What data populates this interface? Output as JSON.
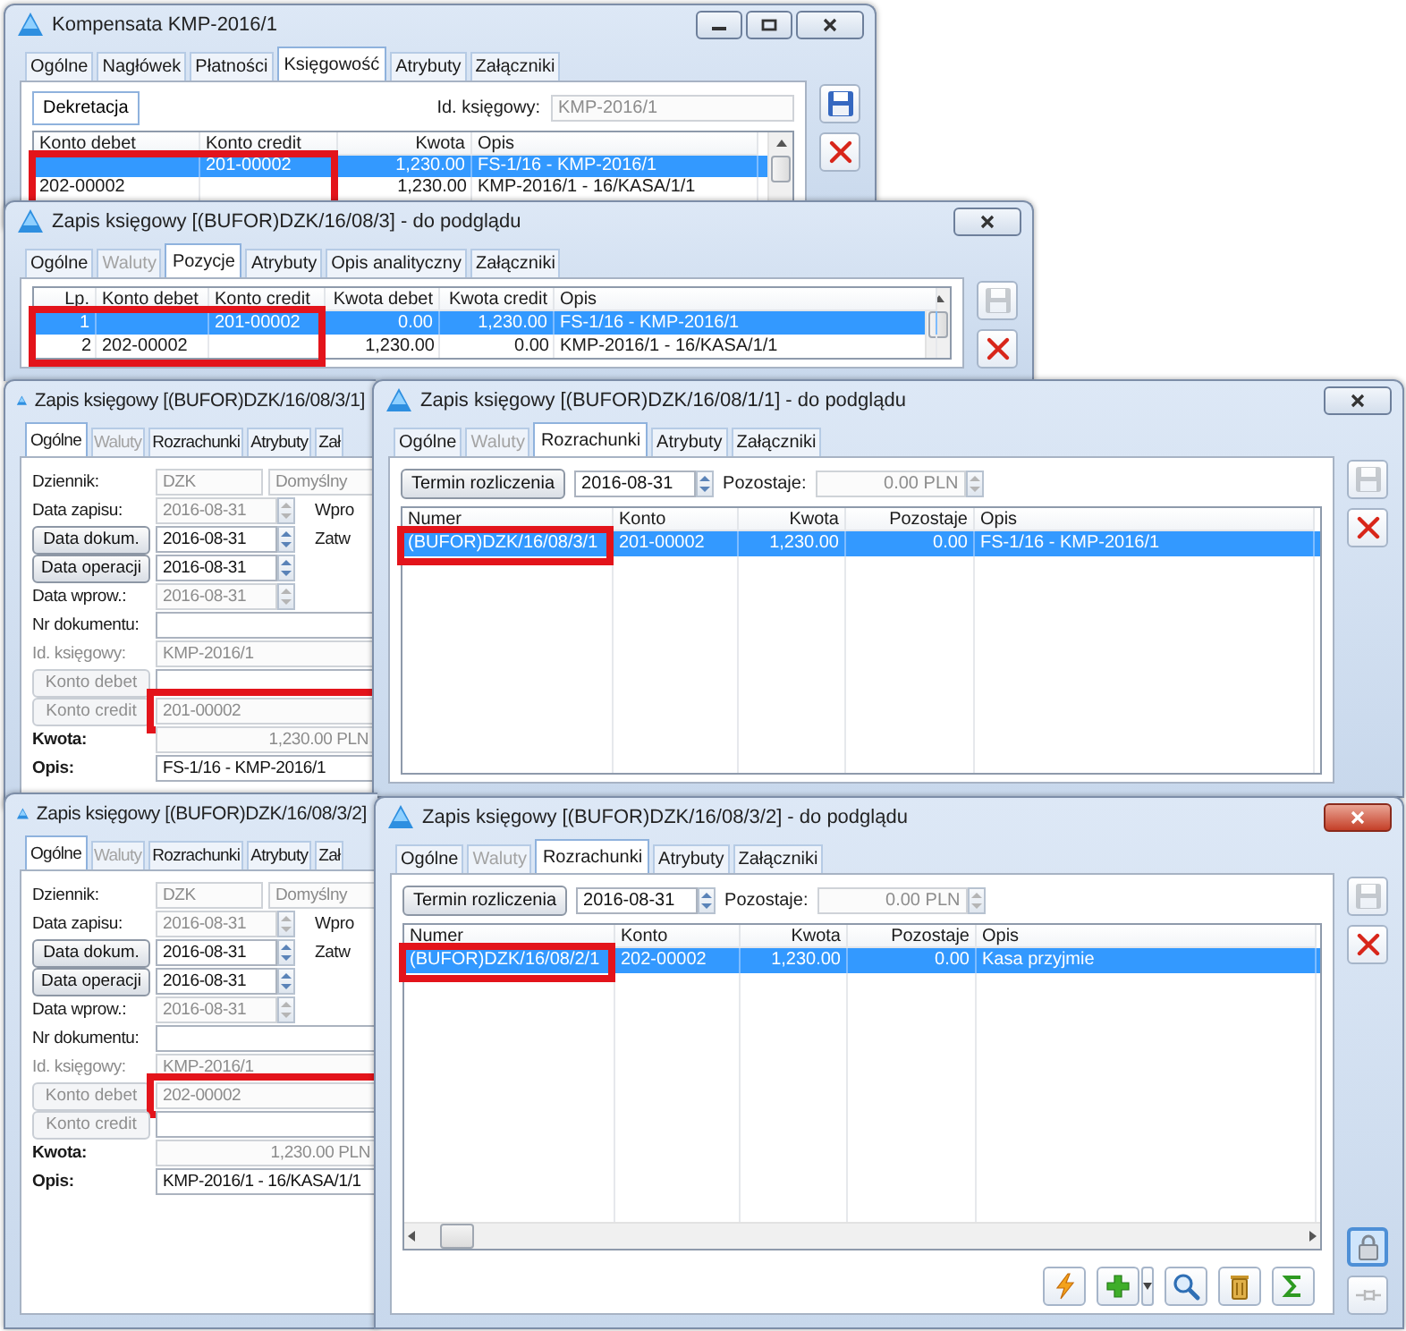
{
  "windows": [
    {
      "title": "Kompensata KMP-2016/1",
      "active": false,
      "title_buttons": [
        {
          "kind": "minimize"
        },
        {
          "kind": "maximize"
        },
        {
          "kind": "close"
        }
      ],
      "tabs": [
        {
          "label": "Ogólne",
          "selected": false,
          "disabled": false
        },
        {
          "label": "Nagłówek",
          "selected": false,
          "disabled": false
        },
        {
          "label": "Płatności",
          "selected": false,
          "disabled": false
        },
        {
          "label": "Księgowość",
          "selected": true,
          "disabled": false
        },
        {
          "label": "Atrybuty",
          "selected": false,
          "disabled": false
        },
        {
          "label": "Załączniki",
          "selected": false,
          "disabled": false
        }
      ],
      "subtabs": [
        {
          "label": "Dekretacja",
          "selected": true
        }
      ],
      "id_field": {
        "label": "Id. księgowy:",
        "value": "KMP-2016/1",
        "disabled": true
      },
      "table": {
        "columns": [
          {
            "label": "Konto debet",
            "callout": true
          },
          {
            "label": "Konto credit",
            "callout": true
          },
          {
            "label": "Kwota",
            "callout": false
          },
          {
            "label": "Opis",
            "callout": false
          }
        ],
        "rows": [
          {
            "selected": true,
            "cells": [
              null,
              "201-00002",
              "1,230.00",
              "FS-1/16 - KMP-2016/1"
            ]
          },
          {
            "selected": false,
            "cells": [
              "202-00002",
              null,
              "1,230.00",
              "KMP-2016/1 - 16/KASA/1/1"
            ]
          }
        ]
      },
      "side_buttons": [
        {
          "kind": "save",
          "disabled": false,
          "pressed": false
        },
        {
          "kind": "delete",
          "disabled": false,
          "pressed": false
        }
      ]
    },
    {
      "title": "Zapis księgowy [(BUFOR)DZK/16/08/3] - do podglądu",
      "active": false,
      "title_buttons": [
        {
          "kind": "close"
        }
      ],
      "tabs": [
        {
          "label": "Ogólne",
          "selected": false,
          "disabled": false
        },
        {
          "label": "Waluty",
          "selected": false,
          "disabled": true
        },
        {
          "label": "Pozycje",
          "selected": true,
          "disabled": false
        },
        {
          "label": "Atrybuty",
          "selected": false,
          "disabled": false
        },
        {
          "label": "Opis analityczny",
          "selected": false,
          "disabled": false
        },
        {
          "label": "Załączniki",
          "selected": false,
          "disabled": false
        }
      ],
      "table": {
        "columns": [
          {
            "label": "Lp.",
            "callout": true
          },
          {
            "label": "Konto debet",
            "callout": true
          },
          {
            "label": "Konto credit",
            "callout": true
          },
          {
            "label": "Kwota debet",
            "callout": false
          },
          {
            "label": "Kwota credit",
            "callout": false
          },
          {
            "label": "Opis",
            "callout": false
          }
        ],
        "rows": [
          {
            "selected": true,
            "cells": [
              "1",
              null,
              "201-00002",
              "0.00",
              "1,230.00",
              "FS-1/16 - KMP-2016/1"
            ]
          },
          {
            "selected": false,
            "cells": [
              "2",
              "202-00002",
              null,
              "1,230.00",
              "0.00",
              "KMP-2016/1 - 16/KASA/1/1"
            ]
          }
        ]
      },
      "side_buttons": [
        {
          "kind": "save",
          "disabled": true,
          "pressed": false
        },
        {
          "kind": "delete",
          "disabled": false,
          "pressed": false
        }
      ]
    },
    {
      "title": "Zapis księgowy [(BUFOR)DZK/16/08/3/1]",
      "tabs": [
        {
          "label": "Ogólne",
          "selected": true,
          "disabled": false
        },
        {
          "label": "Waluty",
          "selected": false,
          "disabled": true
        },
        {
          "label": "Rozrachunki",
          "selected": false,
          "disabled": false
        },
        {
          "label": "Atrybuty",
          "selected": false,
          "disabled": false
        },
        {
          "label": "Zał",
          "selected": false,
          "disabled": false
        }
      ],
      "form": [
        {
          "kind": "label",
          "label": "Dziennik:",
          "disabled": false,
          "bold": false,
          "fields": [
            {
              "kind": "text",
              "value": "DZK",
              "disabled": true,
              "callout": false
            },
            {
              "kind": "text",
              "value": "Domyślny",
              "disabled": true,
              "callout": false
            }
          ]
        },
        {
          "kind": "label",
          "label": "Data zapisu:",
          "disabled": false,
          "bold": false,
          "fields": [
            {
              "kind": "date",
              "value": "2016-08-31",
              "disabled": true,
              "callout": false
            }
          ],
          "side_text": "Wpro"
        },
        {
          "kind": "button",
          "label": "Data dokum.",
          "disabled": false,
          "bold": false,
          "fields": [
            {
              "kind": "date",
              "value": "2016-08-31",
              "disabled": false,
              "callout": false
            }
          ],
          "side_text": "Zatw"
        },
        {
          "kind": "button",
          "label": "Data operacji",
          "disabled": false,
          "bold": false,
          "fields": [
            {
              "kind": "date",
              "value": "2016-08-31",
              "disabled": false,
              "callout": false
            }
          ]
        },
        {
          "kind": "label",
          "label": "Data wprow.:",
          "disabled": false,
          "bold": false,
          "fields": [
            {
              "kind": "date",
              "value": "2016-08-31",
              "disabled": true,
              "callout": false
            }
          ]
        },
        {
          "kind": "label",
          "label": "Nr dokumentu:",
          "disabled": false,
          "bold": false,
          "fields": [
            {
              "kind": "text",
              "disabled": false,
              "callout": false
            }
          ]
        },
        {
          "kind": "label",
          "label": "Id. księgowy:",
          "disabled": true,
          "bold": false,
          "fields": [
            {
              "kind": "text",
              "value": "KMP-2016/1",
              "disabled": true,
              "callout": false
            }
          ]
        },
        {
          "kind": "button",
          "label": "Konto debet",
          "disabled": true,
          "bold": false,
          "fields": [
            {
              "kind": "text",
              "disabled": false,
              "callout": false
            }
          ]
        },
        {
          "kind": "button",
          "label": "Konto credit",
          "disabled": true,
          "bold": false,
          "fields": [
            {
              "kind": "text",
              "value": "201-00002",
              "disabled": true,
              "callout": true
            }
          ]
        },
        {
          "kind": "label",
          "label": "Kwota:",
          "disabled": false,
          "bold": true,
          "fields": [
            {
              "kind": "amount",
              "value": "1,230.00 PLN",
              "disabled": true,
              "callout": false
            }
          ]
        },
        {
          "kind": "label",
          "label": "Opis:",
          "disabled": false,
          "bold": true,
          "fields": [
            {
              "kind": "text",
              "value": "FS-1/16 - KMP-2016/1",
              "disabled": false,
              "callout": false
            }
          ]
        }
      ]
    },
    {
      "title": "Zapis księgowy [(BUFOR)DZK/16/08/1/1] - do podglądu",
      "active": false,
      "title_buttons": [
        {
          "kind": "close"
        }
      ],
      "tabs": [
        {
          "label": "Ogólne",
          "selected": false,
          "disabled": false
        },
        {
          "label": "Waluty",
          "selected": false,
          "disabled": true
        },
        {
          "label": "Rozrachunki",
          "selected": true,
          "disabled": false
        },
        {
          "label": "Atrybuty",
          "selected": false,
          "disabled": false
        },
        {
          "label": "Załączniki",
          "selected": false,
          "disabled": false
        }
      ],
      "settle_bar": {
        "button": "Termin rozliczenia",
        "date": {
          "value": "2016-08-31",
          "disabled": false
        },
        "label": "Pozostaje:",
        "remaining": {
          "value": "0.00 PLN",
          "disabled": true
        }
      },
      "table": {
        "columns": [
          {
            "label": "Numer",
            "callout": true
          },
          {
            "label": "Konto",
            "callout": false
          },
          {
            "label": "Kwota",
            "callout": false
          },
          {
            "label": "Pozostaje",
            "callout": false
          },
          {
            "label": "Opis",
            "callout": false
          }
        ],
        "rows": [
          {
            "selected": true,
            "cells": [
              "(BUFOR)DZK/16/08/3/1",
              "201-00002",
              "1,230.00",
              "0.00",
              "FS-1/16 - KMP-2016/1"
            ]
          }
        ]
      },
      "side_buttons": [
        {
          "kind": "save",
          "disabled": true,
          "pressed": false
        },
        {
          "kind": "delete",
          "disabled": false,
          "pressed": false
        }
      ]
    },
    {
      "title": "Zapis księgowy [(BUFOR)DZK/16/08/3/2]",
      "tabs": [
        {
          "label": "Ogólne",
          "selected": true,
          "disabled": false
        },
        {
          "label": "Waluty",
          "selected": false,
          "disabled": true
        },
        {
          "label": "Rozrachunki",
          "selected": false,
          "disabled": false
        },
        {
          "label": "Atrybuty",
          "selected": false,
          "disabled": false
        },
        {
          "label": "Zał",
          "selected": false,
          "disabled": false
        }
      ],
      "form": [
        {
          "kind": "label",
          "label": "Dziennik:",
          "disabled": false,
          "bold": false,
          "fields": [
            {
              "kind": "text",
              "value": "DZK",
              "disabled": true,
              "callout": false
            },
            {
              "kind": "text",
              "value": "Domyślny",
              "disabled": true,
              "callout": false
            }
          ]
        },
        {
          "kind": "label",
          "label": "Data zapisu:",
          "disabled": false,
          "bold": false,
          "fields": [
            {
              "kind": "date",
              "value": "2016-08-31",
              "disabled": true,
              "callout": false
            }
          ],
          "side_text": "Wpro"
        },
        {
          "kind": "button",
          "label": "Data dokum.",
          "disabled": false,
          "bold": false,
          "fields": [
            {
              "kind": "date",
              "value": "2016-08-31",
              "disabled": false,
              "callout": false
            }
          ],
          "side_text": "Zatw"
        },
        {
          "kind": "button",
          "label": "Data operacji",
          "disabled": false,
          "bold": false,
          "fields": [
            {
              "kind": "date",
              "value": "2016-08-31",
              "disabled": false,
              "callout": false
            }
          ]
        },
        {
          "kind": "label",
          "label": "Data wprow.:",
          "disabled": false,
          "bold": false,
          "fields": [
            {
              "kind": "date",
              "value": "2016-08-31",
              "disabled": true,
              "callout": false
            }
          ]
        },
        {
          "kind": "label",
          "label": "Nr dokumentu:",
          "disabled": false,
          "bold": false,
          "fields": [
            {
              "kind": "text",
              "disabled": false,
              "callout": false
            }
          ]
        },
        {
          "kind": "label",
          "label": "Id. księgowy:",
          "disabled": true,
          "bold": false,
          "fields": [
            {
              "kind": "text",
              "value": "KMP-2016/1",
              "disabled": true,
              "callout": false
            }
          ]
        },
        {
          "kind": "button",
          "label": "Konto debet",
          "disabled": true,
          "bold": false,
          "fields": [
            {
              "kind": "text",
              "value": "202-00002",
              "disabled": true,
              "callout": true
            }
          ]
        },
        {
          "kind": "button",
          "label": "Konto credit",
          "disabled": true,
          "bold": false,
          "fields": [
            {
              "kind": "text",
              "disabled": false,
              "callout": false
            }
          ]
        },
        {
          "kind": "label",
          "label": "Kwota:",
          "disabled": false,
          "bold": true,
          "fields": [
            {
              "kind": "amount",
              "value": "1,230.00 PLN",
              "disabled": true,
              "callout": false
            }
          ]
        },
        {
          "kind": "label",
          "label": "Opis:",
          "disabled": false,
          "bold": true,
          "fields": [
            {
              "kind": "text",
              "value": "KMP-2016/1 - 16/KASA/1/1",
              "disabled": false,
              "callout": false
            }
          ]
        }
      ]
    },
    {
      "title": "Zapis księgowy [(BUFOR)DZK/16/08/3/2] - do podglądu",
      "active": true,
      "title_buttons": [
        {
          "kind": "close"
        }
      ],
      "tabs": [
        {
          "label": "Ogólne",
          "selected": false,
          "disabled": false
        },
        {
          "label": "Waluty",
          "selected": false,
          "disabled": true
        },
        {
          "label": "Rozrachunki",
          "selected": true,
          "disabled": false
        },
        {
          "label": "Atrybuty",
          "selected": false,
          "disabled": false
        },
        {
          "label": "Załączniki",
          "selected": false,
          "disabled": false
        }
      ],
      "settle_bar": {
        "button": "Termin rozliczenia",
        "date": {
          "value": "2016-08-31",
          "disabled": false
        },
        "label": "Pozostaje:",
        "remaining": {
          "value": "0.00 PLN",
          "disabled": true
        }
      },
      "table": {
        "columns": [
          {
            "label": "Numer",
            "callout": true
          },
          {
            "label": "Konto",
            "callout": false
          },
          {
            "label": "Kwota",
            "callout": false
          },
          {
            "label": "Pozostaje",
            "callout": false
          },
          {
            "label": "Opis",
            "callout": false
          }
        ],
        "rows": [
          {
            "selected": true,
            "cells": [
              "(BUFOR)DZK/16/08/2/1",
              "202-00002",
              "1,230.00",
              "0.00",
              "Kasa przyjmie"
            ]
          }
        ]
      },
      "toolbar": [
        {
          "kind": "lightning",
          "dropdown": false
        },
        {
          "kind": "plus",
          "dropdown": true
        },
        {
          "kind": "magnifier",
          "dropdown": false
        },
        {
          "kind": "trash",
          "dropdown": false
        },
        {
          "kind": "sigma",
          "dropdown": false
        }
      ],
      "side_buttons": [
        {
          "kind": "save",
          "disabled": true,
          "pressed": false
        },
        {
          "kind": "delete",
          "disabled": false,
          "pressed": false
        },
        {
          "kind": "lock",
          "disabled": false,
          "pressed": true
        },
        {
          "kind": "pin",
          "disabled": true,
          "pressed": false
        }
      ]
    }
  ]
}
